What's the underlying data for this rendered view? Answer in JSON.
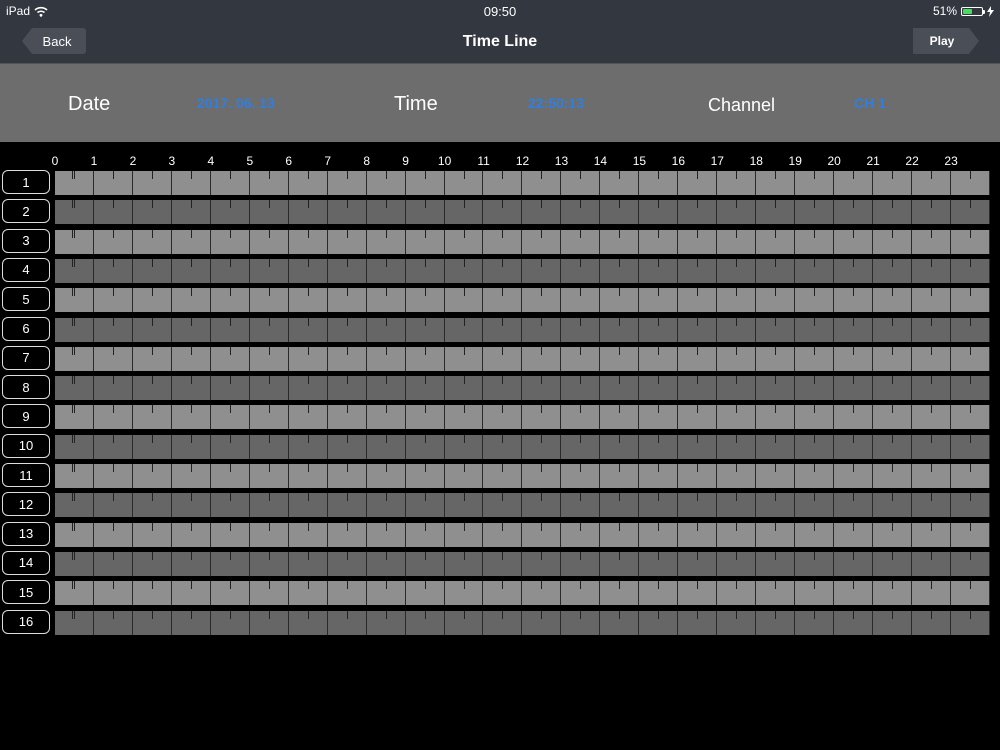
{
  "status_bar": {
    "device": "iPad",
    "time": "09:50",
    "battery": "51%",
    "battery_level": 0.51
  },
  "nav": {
    "title": "Time Line",
    "back_label": "Back",
    "play_label": "Play"
  },
  "info": {
    "date_label": "Date",
    "date_value": "2017. 06. 13",
    "time_label": "Time",
    "time_value": "22:50:13",
    "channel_label": "Channel",
    "channel_value": "CH 1"
  },
  "timeline": {
    "hours": [
      "0",
      "1",
      "2",
      "3",
      "4",
      "5",
      "6",
      "7",
      "8",
      "9",
      "10",
      "11",
      "12",
      "13",
      "14",
      "15",
      "16",
      "17",
      "18",
      "19",
      "20",
      "21",
      "22",
      "23"
    ],
    "channels": [
      "1",
      "2",
      "3",
      "4",
      "5",
      "6",
      "7",
      "8",
      "9",
      "10",
      "11",
      "12",
      "13",
      "14",
      "15",
      "16"
    ]
  },
  "colors": {
    "accent": "#2f7fe0",
    "bar_light": "#8f8f8f",
    "bar_dark": "#666666"
  }
}
